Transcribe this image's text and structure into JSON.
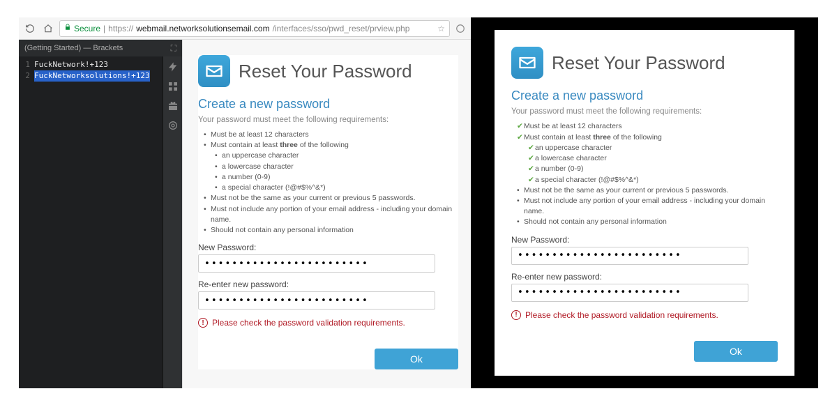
{
  "browser": {
    "secure_label": "Secure",
    "url_scheme": "https://",
    "url_host": "webmail.networksolutionsemail.com",
    "url_path": "/interfaces/sso/pwd_reset/prview.php"
  },
  "editor": {
    "title": "(Getting Started) — Brackets",
    "lines": [
      {
        "n": "1",
        "text": "FuckNetwork!+123",
        "selected": false
      },
      {
        "n": "2",
        "text": "FuckNetworksolutions!+123",
        "selected": true
      }
    ]
  },
  "reset": {
    "title": "Reset Your Password",
    "section_title": "Create a new password",
    "section_sub": "Your password must meet the following requirements:",
    "req_min_len": "Must be at least 12 characters",
    "req_three_prefix": "Must contain at least ",
    "req_three_bold": "three",
    "req_three_suffix": " of the following",
    "req_upper": "an uppercase character",
    "req_lower": "a lowercase character",
    "req_number": "a number (0-9)",
    "req_special": "a special character (!@#$%^&*)",
    "req_not_same": "Must not be the same as your current or previous 5 passwords.",
    "req_not_email": "Must not include any portion of your email address - including your domain name.",
    "req_not_personal": "Should not contain any personal information",
    "label_new": "New Password:",
    "label_re": "Re-enter new password:",
    "pw_mask_1": "••••••••••••••••••••••••",
    "pw_mask_2": "••••••••••••••••••••••••",
    "error": "Please check the password validation requirements.",
    "ok": "Ok"
  }
}
